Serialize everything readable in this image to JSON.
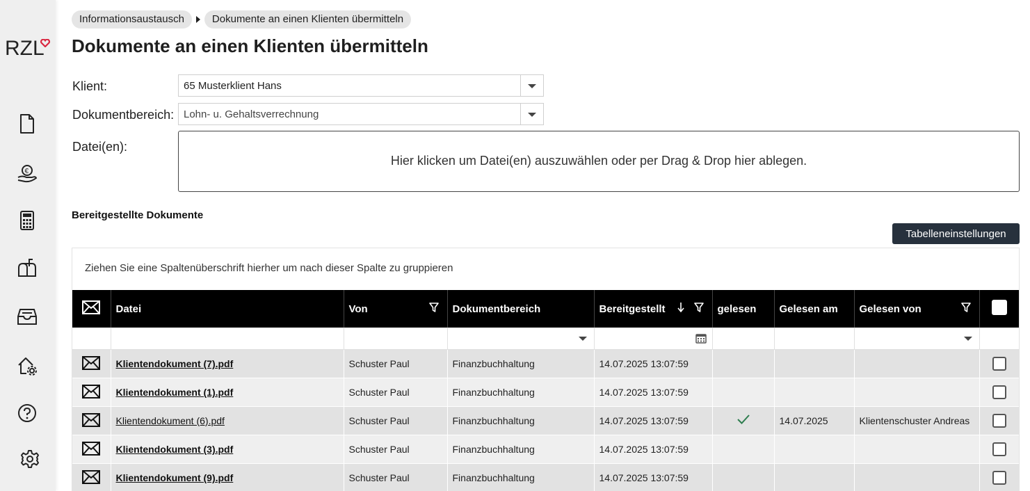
{
  "logo": {
    "text": "RZL",
    "heart_color": "#d9263f"
  },
  "sidebar": {
    "items": [
      {
        "icon": "document-icon"
      },
      {
        "icon": "euro-hand-icon"
      },
      {
        "icon": "calculator-icon"
      },
      {
        "icon": "mailbox-icon"
      },
      {
        "icon": "inbox-tray-icon"
      },
      {
        "icon": "home-settings-icon"
      },
      {
        "icon": "help-icon"
      },
      {
        "icon": "gear-icon"
      }
    ]
  },
  "breadcrumb": {
    "item1": "Informationsaustausch",
    "item2": "Dokumente an einen Klienten übermitteln"
  },
  "page_title": "Dokumente an einen Klienten übermitteln",
  "form": {
    "klient_label": "Klient:",
    "klient_value": "65 Musterklient Hans",
    "bereich_label": "Dokumentbereich:",
    "bereich_value": "Lohn- u. Gehaltsverrechnung",
    "dateien_label": "Datei(en):",
    "dropzone_text": "Hier klicken um Datei(en) auszuwählen oder per Drag & Drop hier ablegen."
  },
  "section_title": "Bereitgestellte Dokumente",
  "table_settings_label": "Tabelleneinstellungen",
  "grid": {
    "group_hint": "Ziehen Sie eine Spaltenüberschrift hierher um nach dieser Spalte zu gruppieren",
    "columns": {
      "datei": "Datei",
      "von": "Von",
      "dokumentbereich": "Dokumentbereich",
      "bereitgestellt": "Bereitgestellt",
      "gelesen": "gelesen",
      "gelesen_am": "Gelesen am",
      "gelesen_von": "Gelesen von"
    },
    "rows": [
      {
        "datei": "Klientendokument (7).pdf",
        "von": "Schuster Paul",
        "bereich": "Finanzbuchhaltung",
        "bereitgestellt": "14.07.2025 13:07:59",
        "gelesen": "",
        "gelesen_am": "",
        "gelesen_von": ""
      },
      {
        "datei": "Klientendokument (1).pdf",
        "von": "Schuster Paul",
        "bereich": "Finanzbuchhaltung",
        "bereitgestellt": "14.07.2025 13:07:59",
        "gelesen": "",
        "gelesen_am": "",
        "gelesen_von": ""
      },
      {
        "datei": "Klientendokument (6).pdf",
        "von": "Schuster Paul",
        "bereich": "Finanzbuchhaltung",
        "bereitgestellt": "14.07.2025 13:07:59",
        "gelesen": "✓",
        "gelesen_am": "14.07.2025",
        "gelesen_von": "Klientenschuster Andreas"
      },
      {
        "datei": "Klientendokument (3).pdf",
        "von": "Schuster Paul",
        "bereich": "Finanzbuchhaltung",
        "bereitgestellt": "14.07.2025 13:07:59",
        "gelesen": "",
        "gelesen_am": "",
        "gelesen_von": ""
      },
      {
        "datei": "Klientendokument (9).pdf",
        "von": "Schuster Paul",
        "bereich": "Finanzbuchhaltung",
        "bereitgestellt": "14.07.2025 13:07:59",
        "gelesen": "",
        "gelesen_am": "",
        "gelesen_von": ""
      }
    ]
  },
  "colors": {
    "header_bg": "#000000",
    "button_bg": "#27313d",
    "check_color": "#2e7d4f"
  }
}
